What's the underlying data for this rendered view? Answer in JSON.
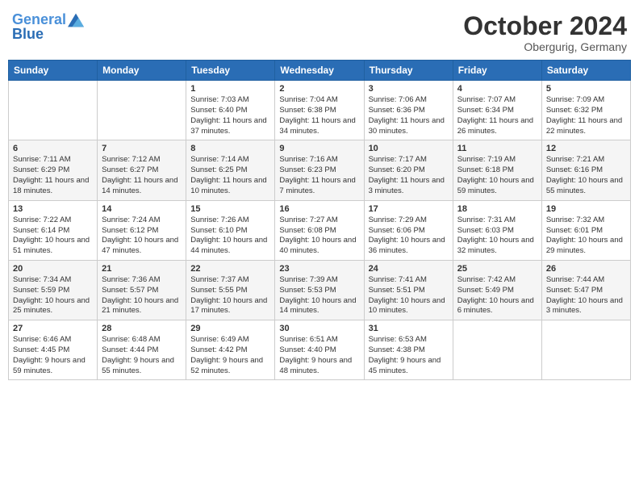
{
  "header": {
    "logo_line1": "General",
    "logo_line2": "Blue",
    "month": "October 2024",
    "location": "Obergurig, Germany"
  },
  "weekdays": [
    "Sunday",
    "Monday",
    "Tuesday",
    "Wednesday",
    "Thursday",
    "Friday",
    "Saturday"
  ],
  "weeks": [
    [
      {
        "day": "",
        "info": ""
      },
      {
        "day": "",
        "info": ""
      },
      {
        "day": "1",
        "info": "Sunrise: 7:03 AM\nSunset: 6:40 PM\nDaylight: 11 hours and 37 minutes."
      },
      {
        "day": "2",
        "info": "Sunrise: 7:04 AM\nSunset: 6:38 PM\nDaylight: 11 hours and 34 minutes."
      },
      {
        "day": "3",
        "info": "Sunrise: 7:06 AM\nSunset: 6:36 PM\nDaylight: 11 hours and 30 minutes."
      },
      {
        "day": "4",
        "info": "Sunrise: 7:07 AM\nSunset: 6:34 PM\nDaylight: 11 hours and 26 minutes."
      },
      {
        "day": "5",
        "info": "Sunrise: 7:09 AM\nSunset: 6:32 PM\nDaylight: 11 hours and 22 minutes."
      }
    ],
    [
      {
        "day": "6",
        "info": "Sunrise: 7:11 AM\nSunset: 6:29 PM\nDaylight: 11 hours and 18 minutes."
      },
      {
        "day": "7",
        "info": "Sunrise: 7:12 AM\nSunset: 6:27 PM\nDaylight: 11 hours and 14 minutes."
      },
      {
        "day": "8",
        "info": "Sunrise: 7:14 AM\nSunset: 6:25 PM\nDaylight: 11 hours and 10 minutes."
      },
      {
        "day": "9",
        "info": "Sunrise: 7:16 AM\nSunset: 6:23 PM\nDaylight: 11 hours and 7 minutes."
      },
      {
        "day": "10",
        "info": "Sunrise: 7:17 AM\nSunset: 6:20 PM\nDaylight: 11 hours and 3 minutes."
      },
      {
        "day": "11",
        "info": "Sunrise: 7:19 AM\nSunset: 6:18 PM\nDaylight: 10 hours and 59 minutes."
      },
      {
        "day": "12",
        "info": "Sunrise: 7:21 AM\nSunset: 6:16 PM\nDaylight: 10 hours and 55 minutes."
      }
    ],
    [
      {
        "day": "13",
        "info": "Sunrise: 7:22 AM\nSunset: 6:14 PM\nDaylight: 10 hours and 51 minutes."
      },
      {
        "day": "14",
        "info": "Sunrise: 7:24 AM\nSunset: 6:12 PM\nDaylight: 10 hours and 47 minutes."
      },
      {
        "day": "15",
        "info": "Sunrise: 7:26 AM\nSunset: 6:10 PM\nDaylight: 10 hours and 44 minutes."
      },
      {
        "day": "16",
        "info": "Sunrise: 7:27 AM\nSunset: 6:08 PM\nDaylight: 10 hours and 40 minutes."
      },
      {
        "day": "17",
        "info": "Sunrise: 7:29 AM\nSunset: 6:06 PM\nDaylight: 10 hours and 36 minutes."
      },
      {
        "day": "18",
        "info": "Sunrise: 7:31 AM\nSunset: 6:03 PM\nDaylight: 10 hours and 32 minutes."
      },
      {
        "day": "19",
        "info": "Sunrise: 7:32 AM\nSunset: 6:01 PM\nDaylight: 10 hours and 29 minutes."
      }
    ],
    [
      {
        "day": "20",
        "info": "Sunrise: 7:34 AM\nSunset: 5:59 PM\nDaylight: 10 hours and 25 minutes."
      },
      {
        "day": "21",
        "info": "Sunrise: 7:36 AM\nSunset: 5:57 PM\nDaylight: 10 hours and 21 minutes."
      },
      {
        "day": "22",
        "info": "Sunrise: 7:37 AM\nSunset: 5:55 PM\nDaylight: 10 hours and 17 minutes."
      },
      {
        "day": "23",
        "info": "Sunrise: 7:39 AM\nSunset: 5:53 PM\nDaylight: 10 hours and 14 minutes."
      },
      {
        "day": "24",
        "info": "Sunrise: 7:41 AM\nSunset: 5:51 PM\nDaylight: 10 hours and 10 minutes."
      },
      {
        "day": "25",
        "info": "Sunrise: 7:42 AM\nSunset: 5:49 PM\nDaylight: 10 hours and 6 minutes."
      },
      {
        "day": "26",
        "info": "Sunrise: 7:44 AM\nSunset: 5:47 PM\nDaylight: 10 hours and 3 minutes."
      }
    ],
    [
      {
        "day": "27",
        "info": "Sunrise: 6:46 AM\nSunset: 4:45 PM\nDaylight: 9 hours and 59 minutes."
      },
      {
        "day": "28",
        "info": "Sunrise: 6:48 AM\nSunset: 4:44 PM\nDaylight: 9 hours and 55 minutes."
      },
      {
        "day": "29",
        "info": "Sunrise: 6:49 AM\nSunset: 4:42 PM\nDaylight: 9 hours and 52 minutes."
      },
      {
        "day": "30",
        "info": "Sunrise: 6:51 AM\nSunset: 4:40 PM\nDaylight: 9 hours and 48 minutes."
      },
      {
        "day": "31",
        "info": "Sunrise: 6:53 AM\nSunset: 4:38 PM\nDaylight: 9 hours and 45 minutes."
      },
      {
        "day": "",
        "info": ""
      },
      {
        "day": "",
        "info": ""
      }
    ]
  ]
}
